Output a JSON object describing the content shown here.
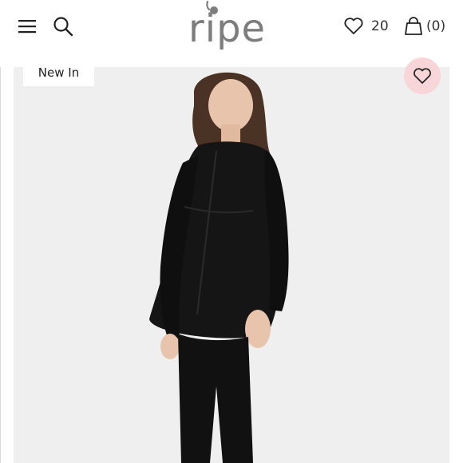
{
  "header": {
    "menu_icon": "hamburger-menu-icon",
    "search_icon": "search-icon",
    "logo_text": "ripe",
    "wishlist_icon": "heart-icon",
    "wishlist_count": "20",
    "bag_icon": "shopping-bag-icon",
    "bag_count": "(0)"
  },
  "product": {
    "badge": "New In",
    "favorite_icon": "heart-icon",
    "image_description": "model wearing black maternity shirt"
  },
  "colors": {
    "logo": "#7d7d7d",
    "favorite_bg": "#f7d5d8",
    "image_bg": "#efeff0"
  }
}
